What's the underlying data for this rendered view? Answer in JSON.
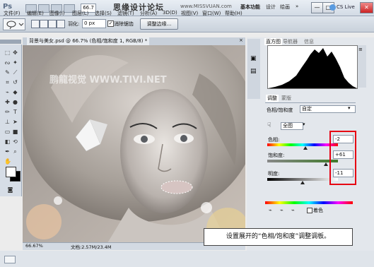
{
  "menubar": {
    "logo": "Ps",
    "zoom": "66.7",
    "items": [
      "文件(F)",
      "编辑(E)",
      "图像(I)",
      "图层(L)",
      "选择(S)",
      "滤镜(T)",
      "分析(A)",
      "3D(D)",
      "视图(V)",
      "窗口(W)",
      "帮助(H)"
    ],
    "watermark": "思缘设计论坛",
    "watermark_url": "www.MISSVUAN.com",
    "workspace_basic": "基本功能",
    "workspace_design": "设计",
    "workspace_paint": "绘画",
    "cs_live": "CS Live",
    "minimize": "—",
    "maximize": "□",
    "close": "✕"
  },
  "options": {
    "feather_label": "羽化:",
    "feather_value": "0 px",
    "antialias_label": "消除锯齿",
    "antialias_checked": "✓",
    "refine_edge": "调整边缘..."
  },
  "document": {
    "tab_title": "背景与美女.psd @ 66.7% (色相/饱和度 1, RGB/8) *",
    "close": "×",
    "canvas_watermark": "鹏龍视觉 WWW.TIVI.NET",
    "zoom_status": "66.67%",
    "doc_size": "文档:2.57M/23.4M"
  },
  "panels": {
    "hist_tabs": [
      "直方图",
      "导航器",
      "信息"
    ],
    "adj_tabs": [
      "调整",
      "蒙版"
    ],
    "adj_title": "色相/饱和度",
    "preset": "自定",
    "channel": "全图",
    "hue_label": "色相:",
    "hue_value": "-2",
    "sat_label": "饱和度:",
    "sat_value": "+61",
    "light_label": "明度:",
    "light_value": "-11",
    "colorize_label": "着色"
  },
  "callout": {
    "text": "设置展开的“色相/饱和度”调整调板。"
  },
  "colors": {
    "highlight": "#e60012",
    "ui_bg": "#e3e7ec"
  }
}
